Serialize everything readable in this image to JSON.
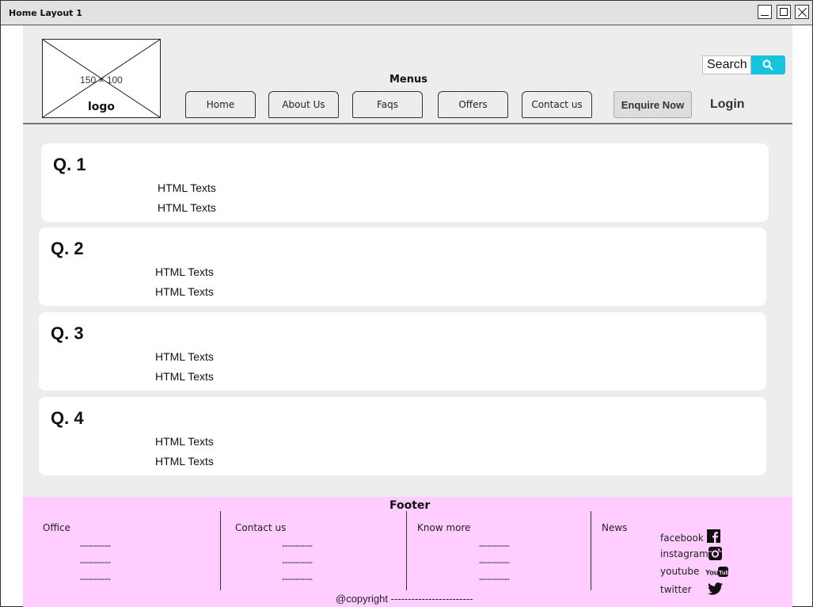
{
  "window": {
    "title": "Home Layout 1"
  },
  "header": {
    "logo": {
      "dimensions": "150 × 100",
      "label": "logo"
    },
    "menus_title": "Menus",
    "nav": [
      "Home",
      "About Us",
      "Faqs",
      "Offers",
      "Contact us"
    ],
    "enquire": "Enquire Now",
    "login": "Login",
    "search": {
      "value": "Search",
      "icon": "search-icon",
      "accent": "#18c3dd"
    }
  },
  "faqs": [
    {
      "question": "Q. 1",
      "lines": [
        "HTML Texts",
        "HTML Texts"
      ]
    },
    {
      "question": "Q. 2",
      "lines": [
        "HTML Texts",
        "HTML Texts"
      ]
    },
    {
      "question": "Q. 3",
      "lines": [
        "HTML Texts",
        "HTML Texts"
      ]
    },
    {
      "question": "Q. 4",
      "lines": [
        "HTML Texts",
        "HTML Texts"
      ]
    }
  ],
  "footer": {
    "title": "Footer",
    "background": "#ffcdff",
    "columns": [
      {
        "heading": "Office",
        "lines": [
          "-----------",
          "-----------",
          "-----------"
        ]
      },
      {
        "heading": "Contact us",
        "lines": [
          "-----------",
          "-----------",
          "-----------"
        ]
      },
      {
        "heading": "Know more",
        "lines": [
          "-----------",
          "-----------",
          "-----------"
        ]
      },
      {
        "heading": "News",
        "lines": []
      }
    ],
    "social": [
      {
        "label": "facebook",
        "icon": "facebook-icon"
      },
      {
        "label": "instagram",
        "icon": "instagram-icon"
      },
      {
        "label": "youtube",
        "icon": "youtube-icon"
      },
      {
        "label": "twitter",
        "icon": "twitter-icon"
      }
    ],
    "copyright": "@copyright ------------------------"
  }
}
